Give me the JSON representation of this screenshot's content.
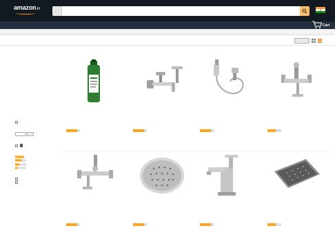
{
  "nav": {
    "logo": "amazon",
    "logo_suffix": ".in",
    "search_placeholder": "",
    "dept_line1": "",
    "dept_line2": "",
    "links": [
      "",
      "",
      "",
      "",
      "",
      ""
    ],
    "account_line1": "",
    "account_line2": "",
    "orders_line1": "",
    "orders_line2": "",
    "cart_count": "",
    "cart_label": "Cart",
    "accent_color": "#febd69",
    "bar_color": "#131921",
    "subbar_color": "#232f3e"
  },
  "subnav": {
    "items": [
      "",
      "",
      "",
      "",
      "",
      "",
      "",
      "",
      "",
      "",
      "",
      ""
    ]
  },
  "results": {
    "text": "",
    "sort_label": "",
    "sort_value": ""
  },
  "sidebar": {
    "heading_main": "",
    "category_label": "",
    "category_items": [
      "",
      "",
      "",
      "",
      "",
      "",
      "",
      "",
      "",
      "",
      "",
      "",
      "",
      ""
    ],
    "see_more": "",
    "delivery_heading": "",
    "delivery_option": "",
    "pincode_heading": "",
    "pincode_go": "",
    "prime_heading": "",
    "prime_option": "",
    "avg_review_heading": "",
    "avg_review_items": [
      "",
      "",
      "",
      ""
    ],
    "brand_heading": "",
    "brand_items": [
      "",
      ""
    ],
    "last_heading": ""
  },
  "main": {
    "heading": "",
    "products": [
      {
        "icon": "green-bottle-icon",
        "title": "",
        "price": "",
        "rating_count": "",
        "rating": null
      },
      {
        "icon": "wall-faucet-icon",
        "title": "",
        "price": "",
        "rating_count": "",
        "rating": null
      },
      {
        "icon": "health-faucet-icon",
        "title": "",
        "price": "",
        "rating_count": "",
        "rating": null
      },
      {
        "icon": "mixer-tap-icon",
        "title": "",
        "price": "",
        "rating_count": "",
        "rating": null
      },
      {
        "icon": "wall-mixer-icon",
        "title": "",
        "price": "",
        "rating_count": "",
        "rating": null
      },
      {
        "icon": "round-shower-head-icon",
        "title": "",
        "price": "",
        "rating_count": "",
        "rating": null
      },
      {
        "icon": "pillar-tap-icon",
        "title": "",
        "price": "",
        "rating_count": "",
        "rating": null
      },
      {
        "icon": "square-shower-head-icon",
        "title": "",
        "price": "",
        "rating_count": "",
        "rating": null
      }
    ]
  }
}
